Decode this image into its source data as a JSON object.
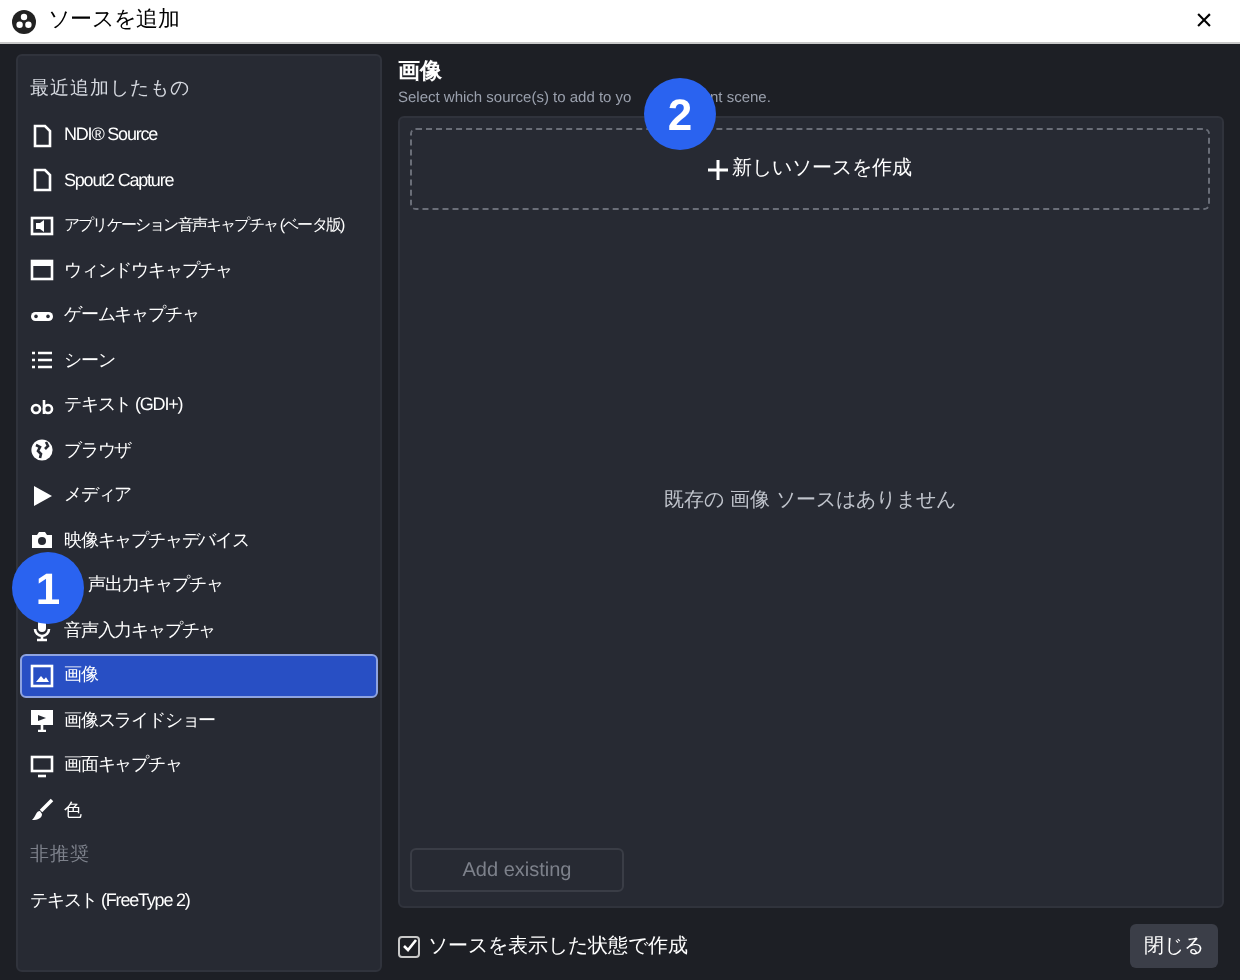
{
  "window": {
    "title": "ソースを追加",
    "close": "×"
  },
  "sidebar": {
    "items": [
      {
        "kind": "section",
        "label": "最近追加したもの"
      },
      {
        "kind": "source",
        "label": "NDI® Source",
        "selected": false
      },
      {
        "kind": "source",
        "label": "Spout2 Capture",
        "selected": false
      },
      {
        "kind": "source",
        "label": "アプリケーション音声キャプチャ (ベータ版)",
        "selected": false
      },
      {
        "kind": "source",
        "label": "ウィンドウキャプチャ",
        "selected": false
      },
      {
        "kind": "source",
        "label": "ゲームキャプチャ",
        "selected": false
      },
      {
        "kind": "source",
        "label": "シーン",
        "selected": false
      },
      {
        "kind": "source",
        "label": "テキスト (GDI+)",
        "selected": false
      },
      {
        "kind": "source",
        "label": "ブラウザ",
        "selected": false
      },
      {
        "kind": "source",
        "label": "メディア",
        "selected": false
      },
      {
        "kind": "source",
        "label": "映像キャプチャデバイス",
        "selected": false
      },
      {
        "kind": "source",
        "label": "声出力キャプチャ",
        "selected": false
      },
      {
        "kind": "source",
        "label": "音声入力キャプチャ",
        "selected": false
      },
      {
        "kind": "source",
        "label": "画像",
        "selected": true
      },
      {
        "kind": "source",
        "label": "画像スライドショー",
        "selected": false
      },
      {
        "kind": "source",
        "label": "画面キャプチャ",
        "selected": false
      },
      {
        "kind": "source",
        "label": "色",
        "selected": false
      },
      {
        "kind": "section",
        "label": "非推奨"
      },
      {
        "kind": "source",
        "label": "テキスト (FreeType 2)",
        "selected": false
      }
    ]
  },
  "main": {
    "heading": "画像",
    "subtitle_start": "Select which source(s) to add to yo",
    "subtitle_end": "nt scene.",
    "create_new": "新しいソースを作成",
    "empty_message": "既存の 画像 ソースはありません",
    "add_existing": {
      "label": "Add existing",
      "disabled": true
    }
  },
  "footer": {
    "visible_checkbox": {
      "label": "ソースを表示した状態で作成",
      "checked": true
    },
    "close_button": "閉じる"
  },
  "annotations": [
    {
      "label": "1"
    },
    {
      "label": "2"
    }
  ]
}
